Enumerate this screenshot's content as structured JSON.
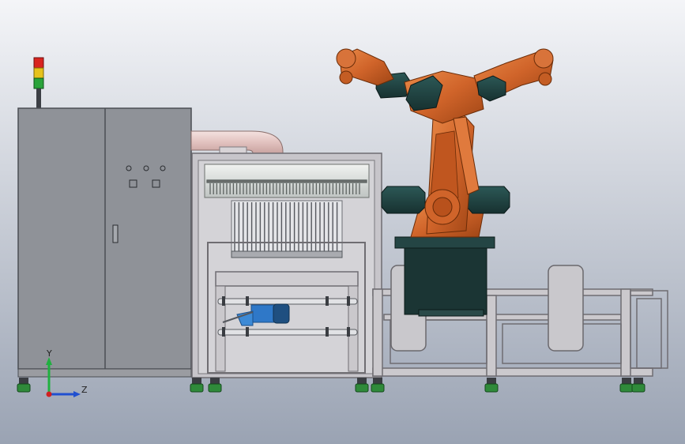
{
  "scene": {
    "background_top": "#f4f5f8",
    "background_bottom": "#9aa3b3",
    "colors": {
      "cabinet_face": "#8f9298",
      "cabinet_edge": "#5a5d63",
      "frame": "#b8b6bb",
      "frame_edge": "#6f6d72",
      "robot_orange": "#d0642a",
      "robot_orange_dark": "#a54a1a",
      "robot_teal": "#1f3f3e",
      "robot_base": "#1a3534",
      "pipe": "#e6c9c6",
      "motor_blue": "#2f78c8",
      "foot_green": "#2f8a3a",
      "beacon_red": "#d9241f",
      "beacon_yellow": "#e6c21c",
      "beacon_green": "#2aa33a"
    }
  },
  "triad": {
    "y_label": "Y",
    "z_label": "Z",
    "y_color": "#20b040",
    "z_color": "#2050d0",
    "origin_color": "#d02020"
  }
}
